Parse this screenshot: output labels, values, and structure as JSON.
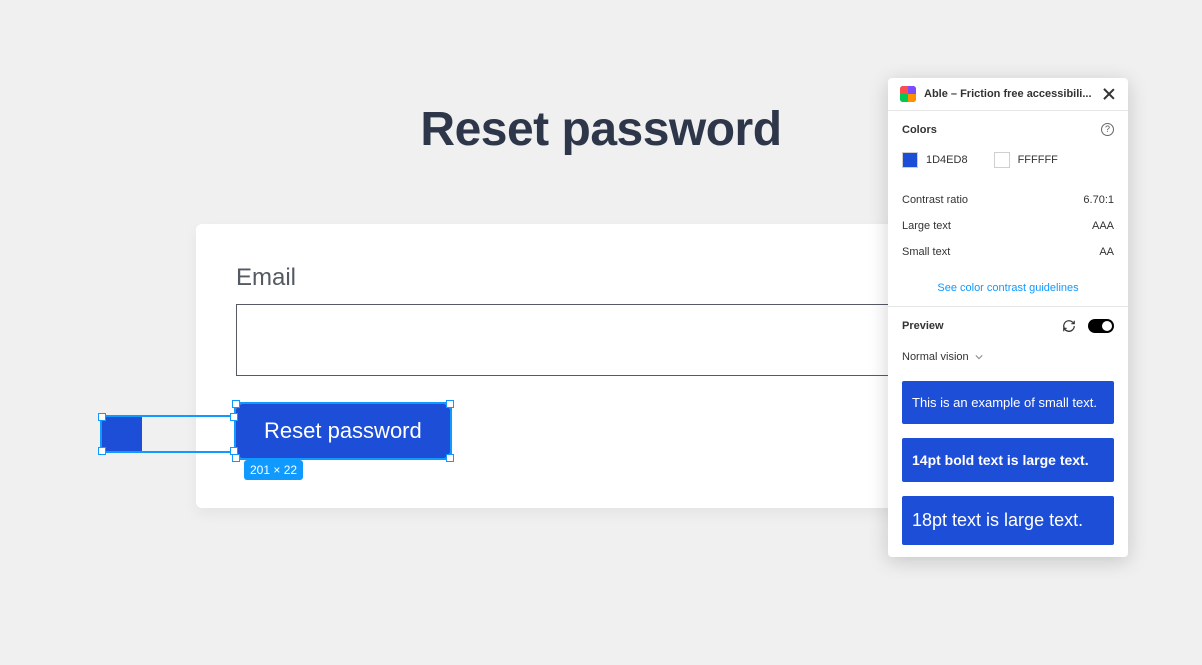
{
  "page": {
    "title": "Reset password"
  },
  "form": {
    "email_label": "Email",
    "submit_label": "Reset password",
    "selection_dimensions": "201 × 22"
  },
  "plugin": {
    "title": "Able – Friction free accessibili...",
    "colors_heading": "Colors",
    "color_fg": {
      "hex": "1D4ED8",
      "css": "#1D4ED8"
    },
    "color_bg": {
      "hex": "FFFFFF",
      "css": "#FFFFFF"
    },
    "metrics": {
      "contrast_label": "Contrast ratio",
      "contrast_value": "6.70:1",
      "large_label": "Large text",
      "large_value": "AAA",
      "small_label": "Small text",
      "small_value": "AA"
    },
    "guidelines_link": "See color contrast guidelines",
    "preview": {
      "heading": "Preview",
      "vision_mode": "Normal vision",
      "sample_small": "This is an example of small text.",
      "sample_bold": "14pt bold text is large text.",
      "sample_large": "18pt text is large text."
    }
  }
}
